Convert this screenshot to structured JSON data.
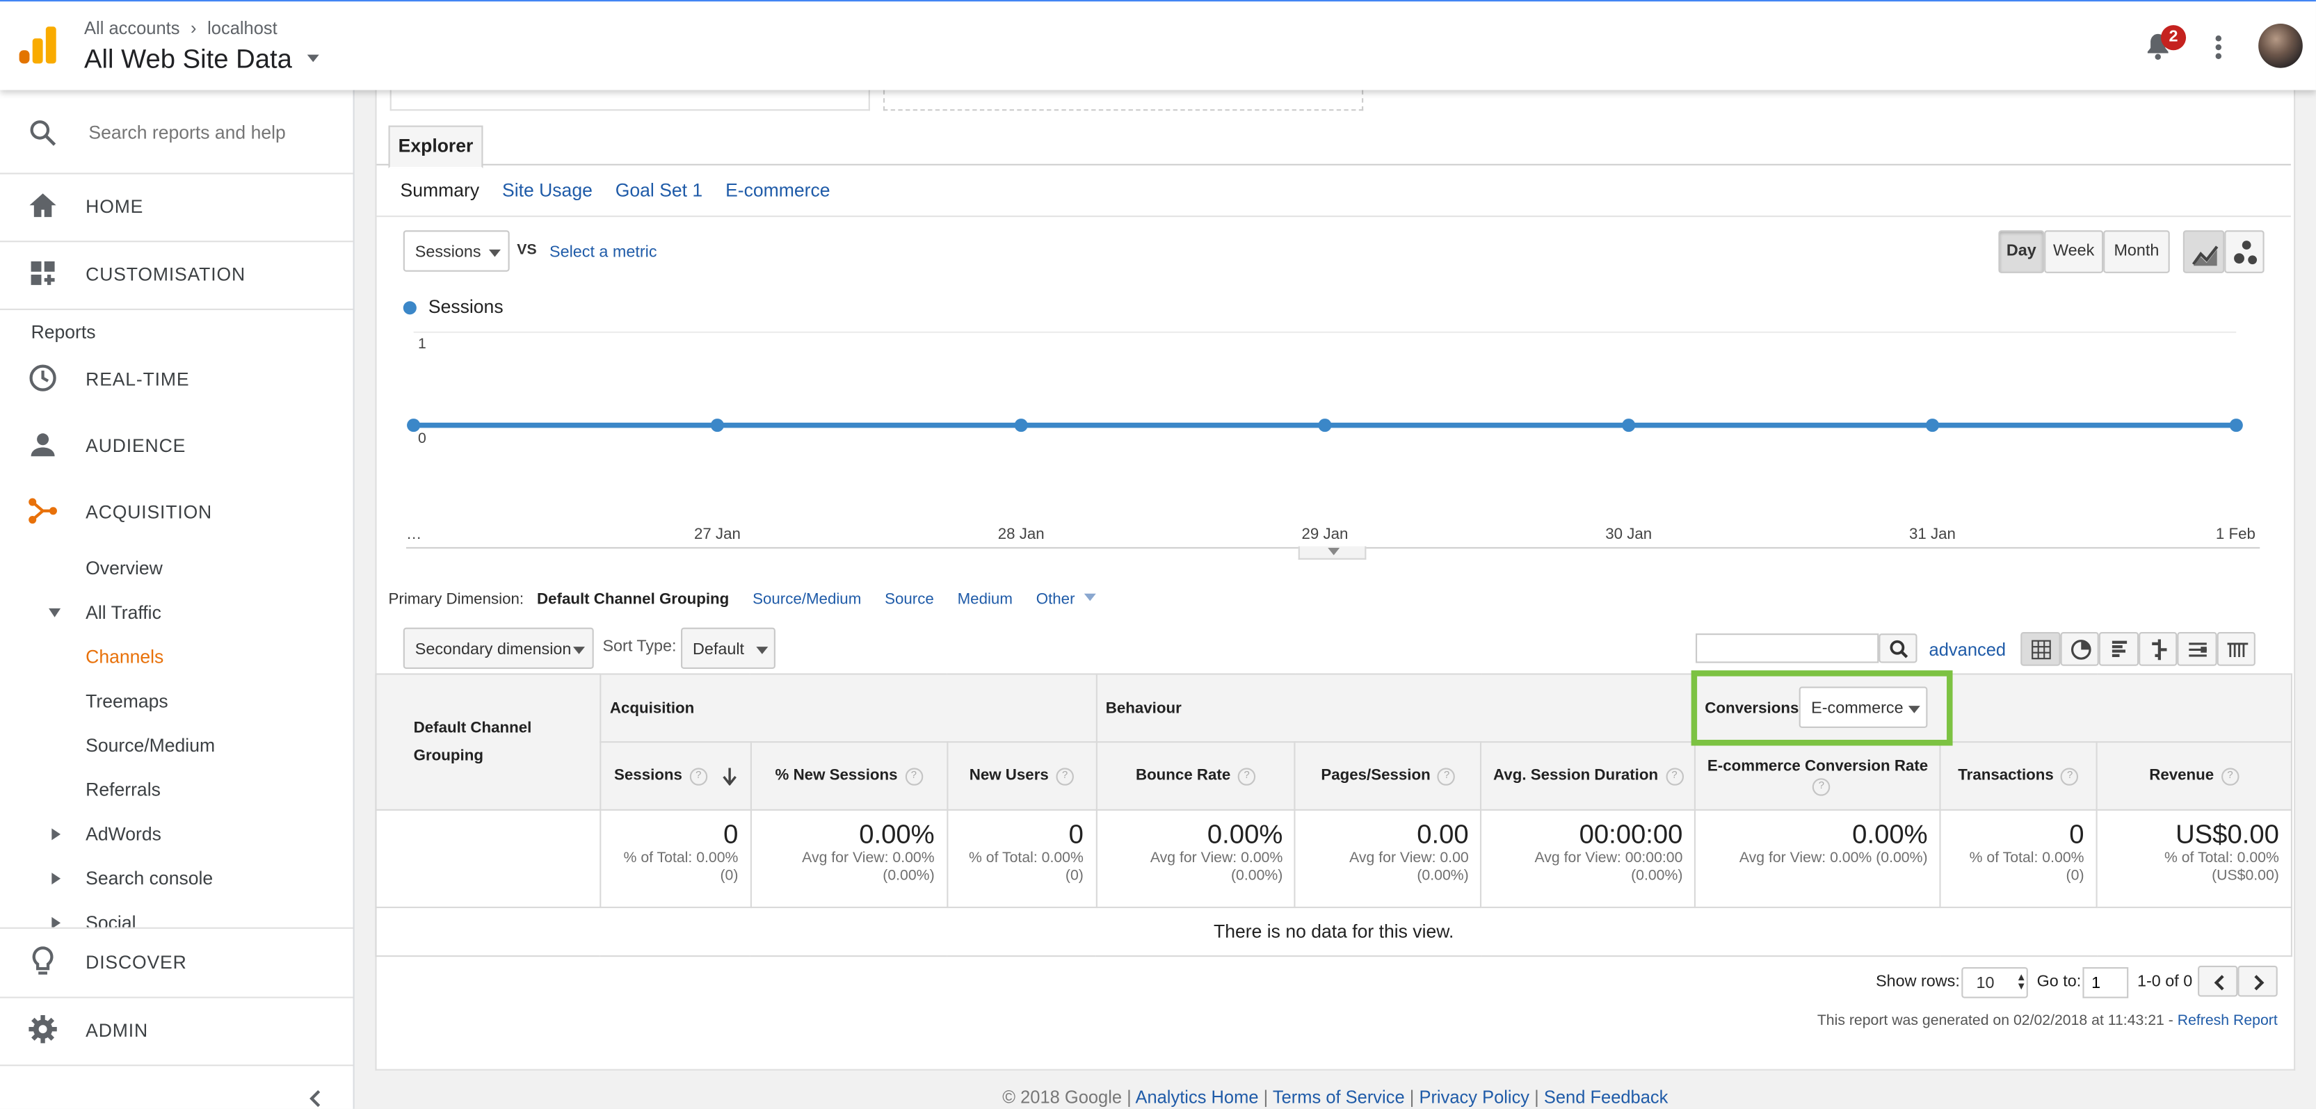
{
  "header": {
    "breadcrumb_root": "All accounts",
    "breadcrumb_sep": "›",
    "breadcrumb_account": "localhost",
    "view_name": "All Web Site Data",
    "notification_count": "2"
  },
  "sidebar": {
    "search_placeholder": "Search reports and help",
    "home": "HOME",
    "customisation": "CUSTOMISATION",
    "reports_heading": "Reports",
    "realtime": "REAL-TIME",
    "audience": "AUDIENCE",
    "acquisition": "ACQUISITION",
    "overview": "Overview",
    "all_traffic": "All Traffic",
    "channels": "Channels",
    "treemaps": "Treemaps",
    "source_medium": "Source/Medium",
    "referrals": "Referrals",
    "adwords": "AdWords",
    "search_console": "Search console",
    "social": "Social",
    "discover": "DISCOVER",
    "admin": "ADMIN",
    "accent_color": "#e8710a"
  },
  "explorer": {
    "tab": "Explorer",
    "subtabs": [
      "Summary",
      "Site Usage",
      "Goal Set 1",
      "E-commerce"
    ],
    "metric": "Sessions",
    "vs": "VS",
    "select_metric": "Select a metric",
    "period_buttons": [
      "Day",
      "Week",
      "Month"
    ],
    "active_period": "Day"
  },
  "chart_data": {
    "type": "line",
    "series": [
      {
        "name": "Sessions",
        "values": [
          0,
          0,
          0,
          0,
          0,
          0,
          0
        ]
      }
    ],
    "x": [
      "…",
      "27 Jan",
      "28 Jan",
      "29 Jan",
      "30 Jan",
      "31 Jan",
      "1 Feb"
    ],
    "y_tick_labels": [
      "1",
      "0"
    ],
    "ylim": [
      0,
      1
    ],
    "color": "#3b87c8"
  },
  "dimensions": {
    "label": "Primary Dimension:",
    "active": "Default Channel Grouping",
    "links": [
      "Source/Medium",
      "Source",
      "Medium",
      "Other"
    ]
  },
  "controls": {
    "secondary_dimension": "Secondary dimension",
    "sort_type_label": "Sort Type:",
    "sort_type_value": "Default",
    "search_value": "",
    "advanced": "advanced"
  },
  "table": {
    "dim_header": "Default Channel Grouping",
    "groups": {
      "acquisition": "Acquisition",
      "behaviour": "Behaviour",
      "conversions": "Conversions",
      "conversions_select": "E-commerce"
    },
    "columns": [
      "Sessions",
      "% New Sessions",
      "New Users",
      "Bounce Rate",
      "Pages/Session",
      "Avg. Session Duration",
      "E-commerce Conversion Rate",
      "Transactions",
      "Revenue"
    ],
    "totals": [
      {
        "value": "0",
        "line1": "% of Total: 0.00%",
        "line2": "(0)"
      },
      {
        "value": "0.00%",
        "line1": "Avg for View: 0.00%",
        "line2": "(0.00%)"
      },
      {
        "value": "0",
        "line1": "% of Total: 0.00%",
        "line2": "(0)"
      },
      {
        "value": "0.00%",
        "line1": "Avg for View: 0.00%",
        "line2": "(0.00%)"
      },
      {
        "value": "0.00",
        "line1": "Avg for View: 0.00",
        "line2": "(0.00%)"
      },
      {
        "value": "00:00:00",
        "line1": "Avg for View: 00:00:00",
        "line2": "(0.00%)"
      },
      {
        "value": "0.00%",
        "line1": "Avg for View: 0.00% (0.00%)",
        "line2": ""
      },
      {
        "value": "0",
        "line1": "% of Total: 0.00%",
        "line2": "(0)"
      },
      {
        "value": "US$0.00",
        "line1": "% of Total: 0.00%",
        "line2": "(US$0.00)"
      }
    ],
    "no_data": "There is no data for this view.",
    "highlight_color": "#7cc242"
  },
  "pagination": {
    "show_rows_label": "Show rows:",
    "rows_value": "10",
    "goto_label": "Go to:",
    "goto_value": "1",
    "range": "1-0 of 0"
  },
  "report_footer": {
    "generated": "This report was generated on 02/02/2018 at 11:43:21 -",
    "refresh": "Refresh Report"
  },
  "footer": {
    "copyright": "© 2018 Google |",
    "links": [
      "Analytics Home",
      "Terms of Service",
      "Privacy Policy",
      "Send Feedback"
    ]
  }
}
